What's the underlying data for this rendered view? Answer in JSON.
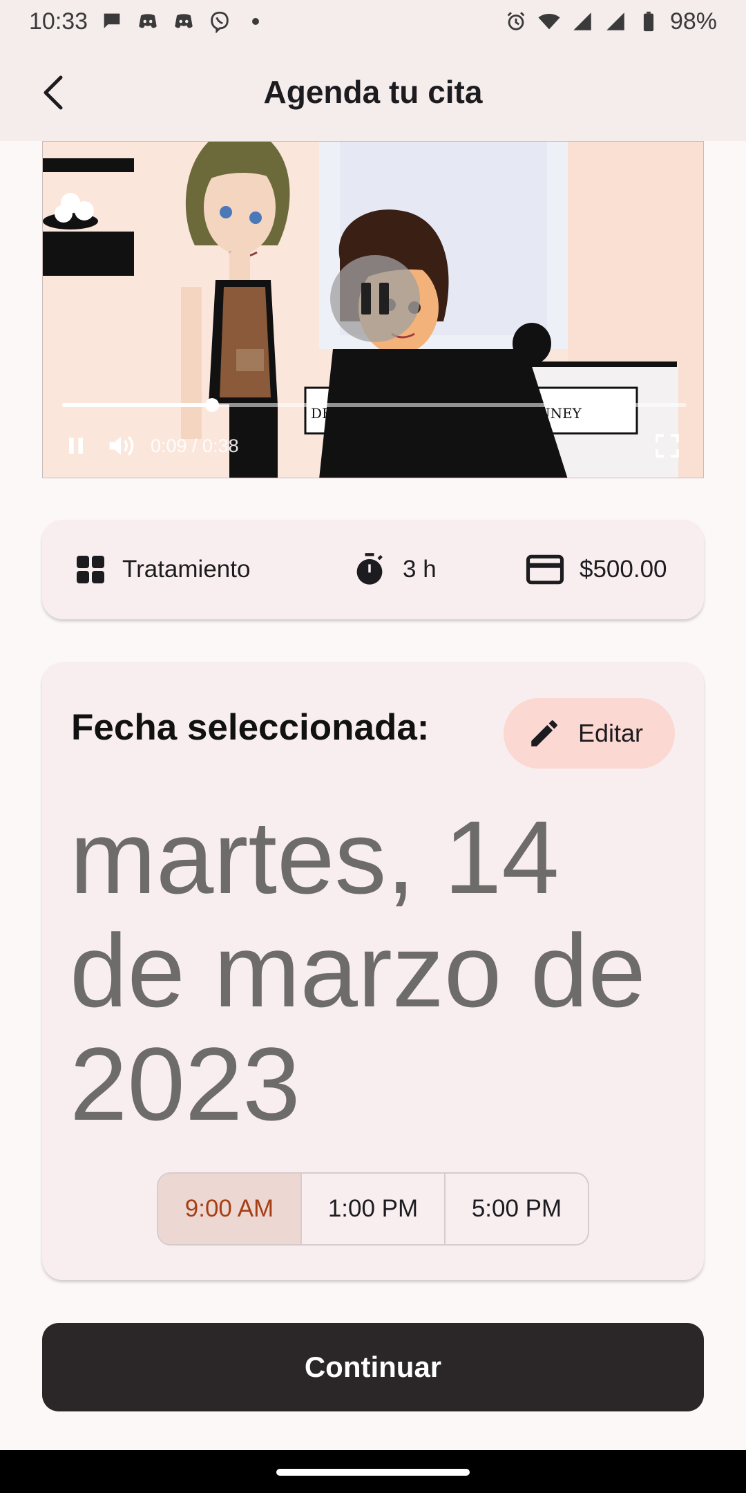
{
  "status_bar": {
    "time": "10:33",
    "battery": "98%",
    "notification_icons": [
      "chat-bubble-icon",
      "discord-icon",
      "discord-icon",
      "viber-icon",
      "dot-icon"
    ],
    "system_icons": [
      "alarm-icon",
      "wifi-icon",
      "signal-icon",
      "signal-icon",
      "battery-icon"
    ]
  },
  "app_bar": {
    "title": "Agenda tu cita",
    "back_icon": "arrow-back-icon"
  },
  "video": {
    "current_time": "0:09",
    "duration": "0:38",
    "time_text": "0:09 / 0:38",
    "progress": 0.24,
    "state": "playing",
    "sign_left": "DELAU",
    "sign_right": "LAUNEY"
  },
  "service_info": {
    "category_icon": "grid-icon",
    "category": "Tratamiento",
    "duration_icon": "timer-icon",
    "duration": "3 h",
    "price_icon": "credit-card-icon",
    "price": "$500.00"
  },
  "date_section": {
    "label": "Fecha seleccionada:",
    "edit_label": "Editar",
    "edit_icon": "pencil-icon",
    "date_text": "martes, 14 de marzo de 2023",
    "time_slots": [
      "9:00 AM",
      "1:00 PM",
      "5:00 PM"
    ],
    "selected_slot": "9:00 AM"
  },
  "continue_label": "Continuar",
  "colors": {
    "app_bar_bg": "#f5ecec",
    "card_bg": "#f8eeef",
    "edit_button_bg": "#fbd8d1",
    "selected_slot_bg": "#ecd7d2",
    "selected_slot_text": "#a63f14",
    "primary_button_bg": "#2b2728"
  }
}
